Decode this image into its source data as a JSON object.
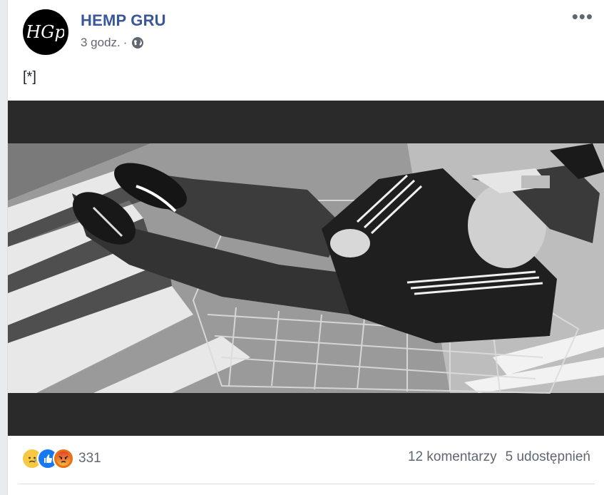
{
  "post": {
    "page_name": "HEMP GRU",
    "logo_text": "HGp",
    "time": "3 godz.",
    "separator": "·",
    "text": "[*]",
    "more_label": "•••"
  },
  "stats": {
    "reaction_icons": [
      "sad-reaction-icon",
      "like-reaction-icon",
      "angry-reaction-icon"
    ],
    "reaction_count": "331",
    "comments": "12 komentarzy",
    "shares": "5 udostępnień"
  },
  "colors": {
    "brand_link": "#385898",
    "muted": "#606770",
    "like_blue": "#1877f2",
    "sad_yellow": "#f7c843",
    "angry_red": "#e9710f"
  }
}
